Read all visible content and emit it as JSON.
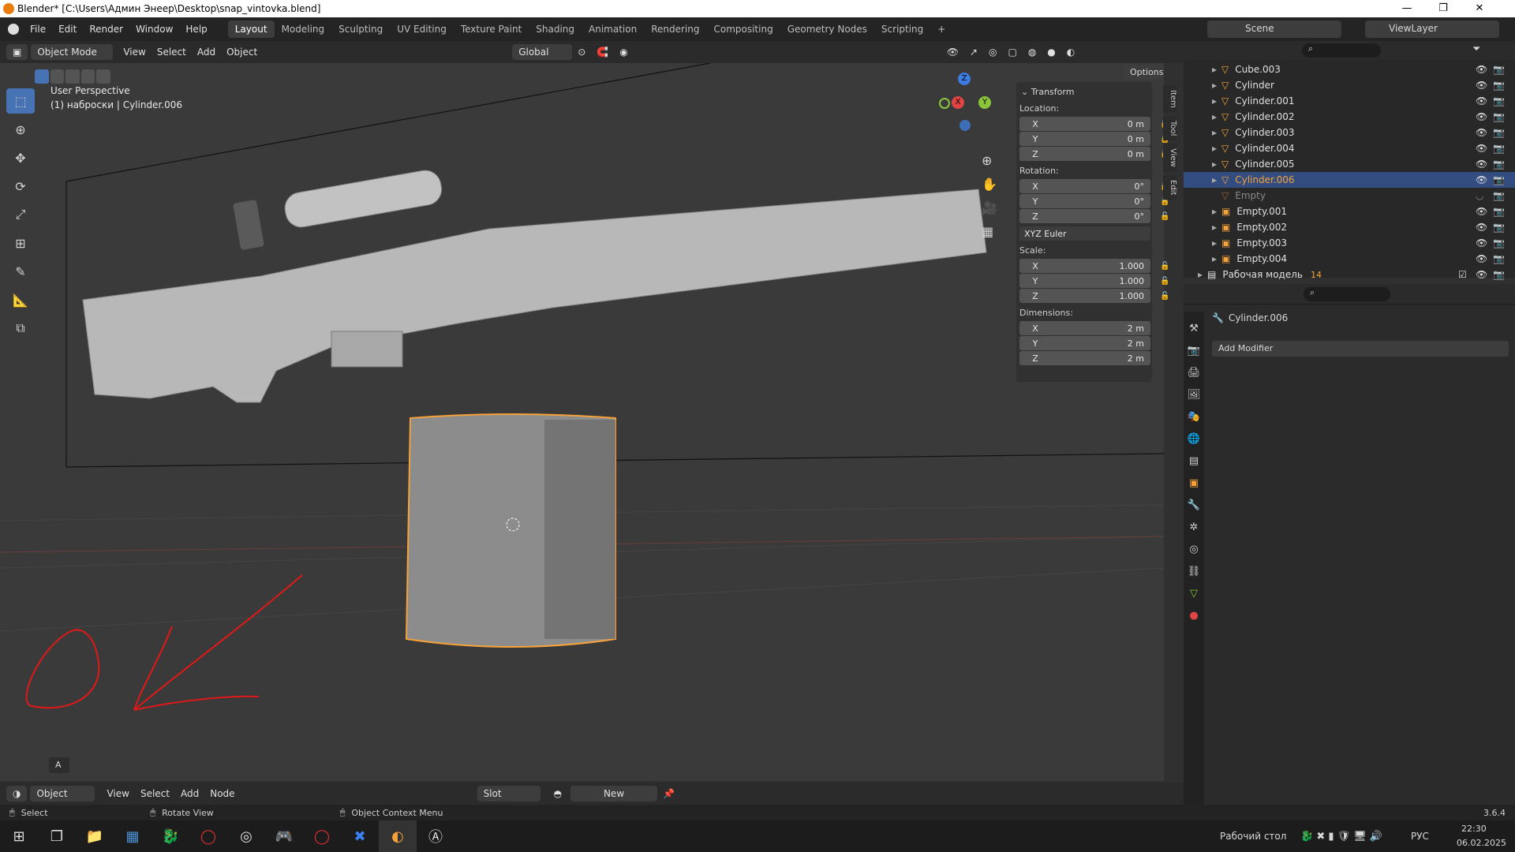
{
  "window": {
    "title": "Blender* [C:\\Users\\Админ Энеер\\Desktop\\snap_vintovka.blend]",
    "minimize": "—",
    "maximize": "❐",
    "close": "✕"
  },
  "menubar": {
    "menus": [
      "File",
      "Edit",
      "Render",
      "Window",
      "Help"
    ],
    "workspaces": [
      "Layout",
      "Modeling",
      "Sculpting",
      "UV Editing",
      "Texture Paint",
      "Shading",
      "Animation",
      "Rendering",
      "Compositing",
      "Geometry Nodes",
      "Scripting"
    ],
    "active_workspace": "Layout",
    "add_tab": "+",
    "scene": "Scene",
    "view_layer": "ViewLayer"
  },
  "viewport_header": {
    "mode": "Object Mode",
    "menus": [
      "View",
      "Select",
      "Add",
      "Object"
    ],
    "orientation": "Global",
    "options": "Options"
  },
  "viewport": {
    "perspective": "User Perspective",
    "context": "(1) наброски | Cylinder.006",
    "gizmo": {
      "z": "Z",
      "x": "X",
      "y": "Y"
    },
    "collapsed_panel": "A",
    "accent": "#f5a23a",
    "annotation_color": "#e01818"
  },
  "npanel": {
    "section": "Transform",
    "location_label": "Location:",
    "location": [
      {
        "axis": "X",
        "value": "0 m"
      },
      {
        "axis": "Y",
        "value": "0 m"
      },
      {
        "axis": "Z",
        "value": "0 m"
      }
    ],
    "rotation_label": "Rotation:",
    "rotation": [
      {
        "axis": "X",
        "value": "0°"
      },
      {
        "axis": "Y",
        "value": "0°"
      },
      {
        "axis": "Z",
        "value": "0°"
      }
    ],
    "rotation_mode": "XYZ Euler",
    "scale_label": "Scale:",
    "scale": [
      {
        "axis": "X",
        "value": "1.000"
      },
      {
        "axis": "Y",
        "value": "1.000"
      },
      {
        "axis": "Z",
        "value": "1.000"
      }
    ],
    "dimensions_label": "Dimensions:",
    "dimensions": [
      {
        "axis": "X",
        "value": "2 m"
      },
      {
        "axis": "Y",
        "value": "2 m"
      },
      {
        "axis": "Z",
        "value": "2 m"
      }
    ],
    "tabs": [
      "Item",
      "Tool",
      "View",
      "Edit"
    ]
  },
  "outliner": {
    "rows": [
      {
        "name": "Cube.003"
      },
      {
        "name": "Cylinder"
      },
      {
        "name": "Cylinder.001"
      },
      {
        "name": "Cylinder.002"
      },
      {
        "name": "Cylinder.003"
      },
      {
        "name": "Cylinder.004"
      },
      {
        "name": "Cylinder.005"
      },
      {
        "name": "Cylinder.006"
      },
      {
        "name": "Empty"
      },
      {
        "name": "Empty.001"
      },
      {
        "name": "Empty.002"
      },
      {
        "name": "Empty.003"
      },
      {
        "name": "Empty.004"
      },
      {
        "name": "Рабочая модель"
      }
    ],
    "selected": "Cylinder.006",
    "collection_count": "14"
  },
  "properties": {
    "object": "Cylinder.006",
    "add_modifier": "Add Modifier"
  },
  "bottom_header": {
    "mode": "Object",
    "menus": [
      "View",
      "Select",
      "Add",
      "Node"
    ],
    "slot": "Slot",
    "new": "New"
  },
  "statusbar": {
    "select": "Select",
    "rotate": "Rotate View",
    "context_menu": "Object Context Menu",
    "version": "3.6.4"
  },
  "taskbar": {
    "desktop": "Рабочий стол",
    "lang": "РУС",
    "time": "22:30",
    "date": "06.02.2025"
  }
}
